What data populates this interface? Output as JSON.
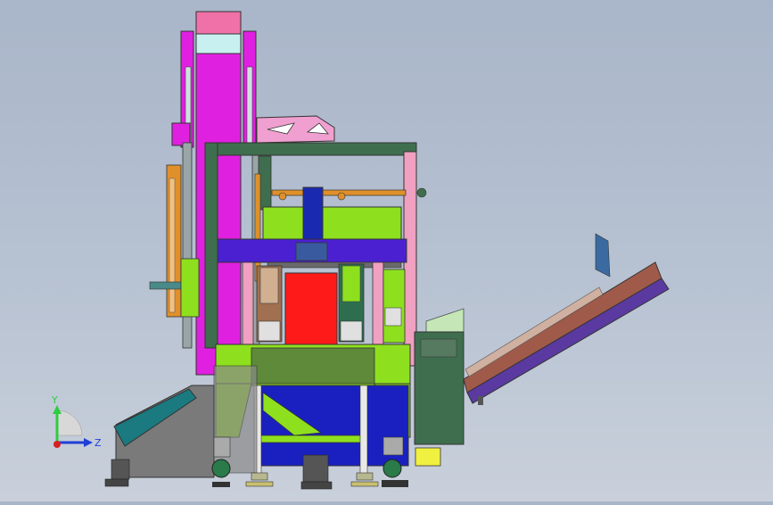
{
  "view": {
    "background_top": "#a9b6c9",
    "background_bottom": "#c9d0db"
  },
  "triad": {
    "y_label": "Y",
    "z_label": "Z",
    "y_color": "#2ecc40",
    "z_color": "#1f3fd6",
    "x_color": "#d62020"
  },
  "colors": {
    "magenta": "#e020e0",
    "lime": "#8ee01e",
    "blue": "#3018c8",
    "red": "#ff1a1a",
    "pink": "#f0a0c0",
    "dark_green": "#3f6e4e",
    "gray": "#7a7a7a",
    "teal": "#1a7a80",
    "brown": "#a05a4a",
    "orange": "#e0902a",
    "cyan": "#c8f0f0"
  }
}
